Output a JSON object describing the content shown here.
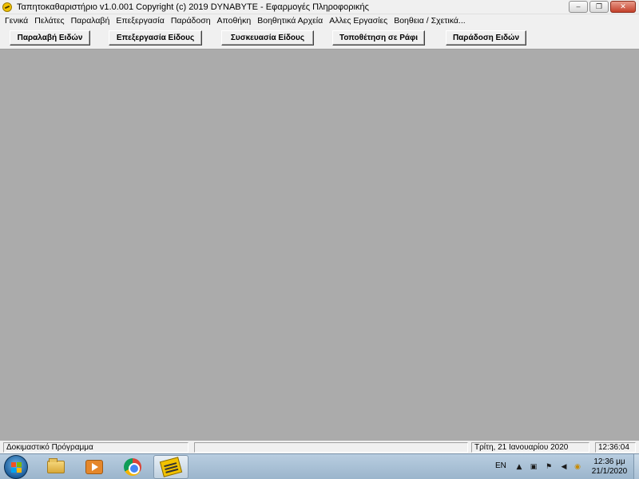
{
  "window": {
    "title": "Ταπητοκαθαριστήριο v1.0.001   Copyright (c) 2019  DYNABYTE - Εφαρμογές Πληροφορικής",
    "controls": {
      "minimize": "‒",
      "maximize": "❐",
      "close": "✕"
    }
  },
  "menu": [
    "Γενικά",
    "Πελάτες",
    "Παραλαβή",
    "Επεξεργασία",
    "Παράδοση",
    "Αποθήκη",
    "Βοηθητικά Αρχεία",
    "Αλλες Εργασίες",
    "Βοηθεια / Σχετικά..."
  ],
  "toolbar": {
    "receive": "Παραλαβή Ειδών",
    "process": "Επεξεργασία Είδους",
    "package": "Συσκευασία Είδους",
    "shelve": "Τοποθέτηση σε Ράφι",
    "deliver": "Παράδοση Ειδών"
  },
  "status": {
    "mode": "Δοκιμαστικό Πρόγραμμα",
    "empty": "",
    "date": "Τρίτη, 21 Ιανουαρίου 2020",
    "time": "12:36:04"
  },
  "taskbar": {
    "items": [
      "windows-explorer",
      "media-player",
      "chrome",
      "cleaning-app"
    ],
    "language": "EN",
    "clock_time": "12:36 μμ",
    "clock_date": "21/1/2020"
  },
  "colors": {
    "workspace": "#ababab",
    "chrome": "#f0f0f0",
    "taskbar": "#b8cde0"
  }
}
